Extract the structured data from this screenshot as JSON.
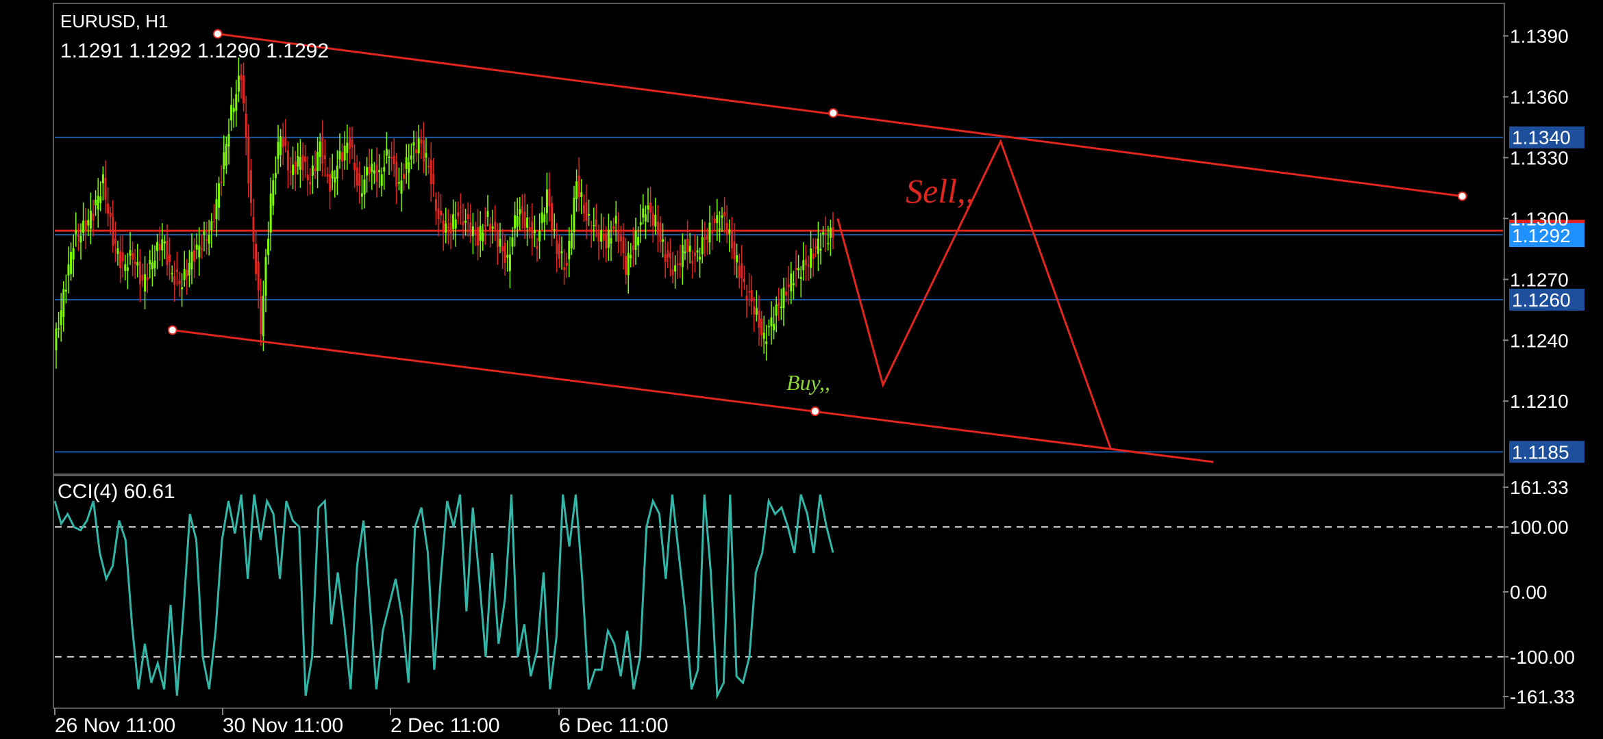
{
  "header": {
    "symbol": "EURUSD, H1",
    "ohlc": "1.1291 1.1292 1.1290 1.1292"
  },
  "indicator": {
    "label": "CCI(4) 60.61"
  },
  "annotations": {
    "sell": "Sell,,",
    "buy": "Buy,,"
  },
  "colors": {
    "background": "#000000",
    "bull": "#7cfc00",
    "bear": "#e0261f",
    "grid": "#1f3a7a",
    "level_line": "#1e5aa8",
    "trendline": "#e0261f",
    "cci": "#33b5a8",
    "sell_text": "#e0261f",
    "buy_text": "#8fd63a",
    "price_badge": "#1e90ff"
  },
  "chart_data": [
    {
      "type": "candlestick",
      "title": "EURUSD, H1",
      "ylim": [
        1.1175,
        1.1405
      ],
      "y_ticks": [
        "1.1390",
        "1.1360",
        "1.1330",
        "1.1300",
        "1.1270",
        "1.1240",
        "1.1210"
      ],
      "x_tick_labels": [
        "26 Nov 11:00",
        "30 Nov 11:00",
        "2 Dec 11:00",
        "6 Dec 11:00"
      ],
      "current_price": "1.1292",
      "horizontal_levels": [
        {
          "price": 1.134,
          "label": "1.1340"
        },
        {
          "price": 1.126,
          "label": "1.1260"
        },
        {
          "price": 1.1185,
          "label": "1.1185"
        },
        {
          "price": 1.1294,
          "label": ""
        }
      ],
      "close_path": [
        1.1235,
        1.1262,
        1.1289,
        1.1295,
        1.1303,
        1.1318,
        1.129,
        1.1276,
        1.1282,
        1.1268,
        1.1279,
        1.129,
        1.1272,
        1.1268,
        1.1281,
        1.1288,
        1.1295,
        1.1322,
        1.1352,
        1.1372,
        1.1304,
        1.1246,
        1.131,
        1.1342,
        1.1322,
        1.133,
        1.1318,
        1.1336,
        1.1316,
        1.133,
        1.1338,
        1.1312,
        1.1326,
        1.132,
        1.1334,
        1.1315,
        1.133,
        1.1338,
        1.1326,
        1.13,
        1.1294,
        1.1303,
        1.1297,
        1.129,
        1.13,
        1.129,
        1.1278,
        1.1305,
        1.1297,
        1.1288,
        1.1312,
        1.1284,
        1.1276,
        1.1318,
        1.13,
        1.1294,
        1.1288,
        1.1298,
        1.1276,
        1.129,
        1.1306,
        1.1298,
        1.1282,
        1.1274,
        1.1286,
        1.128,
        1.129,
        1.1298,
        1.13,
        1.1282,
        1.1266,
        1.1256,
        1.124,
        1.1252,
        1.1262,
        1.1272,
        1.1276,
        1.1283,
        1.1291,
        1.1292
      ],
      "trend_lines": [
        {
          "name": "channel-top",
          "start": [
            0.18,
            1.1391
          ],
          "end": [
            1.555,
            1.1311
          ],
          "anchors": [
            [
              0.18,
              1.1391
            ],
            [
              0.86,
              1.1352
            ],
            [
              1.555,
              1.1311
            ]
          ]
        },
        {
          "name": "channel-bottom",
          "start": [
            0.13,
            1.1245
          ],
          "end": [
            1.28,
            1.118
          ],
          "anchors": [
            [
              0.13,
              1.1245
            ],
            [
              0.84,
              1.1205
            ]
          ]
        },
        {
          "name": "projection-zigzag",
          "points": [
            [
              0.865,
              1.13
            ],
            [
              0.915,
              1.1218
            ],
            [
              1.045,
              1.1338
            ],
            [
              1.167,
              1.1186
            ]
          ]
        }
      ]
    },
    {
      "type": "line",
      "title": "CCI(4) 60.61",
      "ylim": [
        -161.33,
        161.33
      ],
      "y_ticks": [
        "161.33",
        "100.00",
        "0.00",
        "-100.00",
        "-161.33"
      ],
      "dashed_levels": [
        100,
        -100
      ],
      "series": [
        {
          "values": [
            140,
            105,
            120,
            100,
            95,
            110,
            140,
            60,
            20,
            40,
            110,
            80,
            -50,
            -150,
            -80,
            -140,
            -110,
            -150,
            -20,
            -160,
            -30,
            120,
            80,
            -100,
            -150,
            -60,
            80,
            140,
            90,
            150,
            20,
            150,
            80,
            140,
            120,
            20,
            140,
            110,
            100,
            -160,
            -100,
            130,
            140,
            -50,
            30,
            -50,
            -150,
            40,
            110,
            -20,
            -150,
            -60,
            -20,
            20,
            -40,
            -140,
            100,
            130,
            60,
            -120,
            20,
            140,
            100,
            150,
            -30,
            130,
            20,
            -100,
            60,
            -80,
            -10,
            150,
            -100,
            -50,
            -130,
            -90,
            30,
            -150,
            -70,
            150,
            70,
            150,
            20,
            -150,
            -120,
            -120,
            -60,
            -80,
            -130,
            -60,
            -150,
            -100,
            100,
            140,
            120,
            20,
            150,
            60,
            -30,
            -150,
            -120,
            150,
            30,
            -160,
            -140,
            150,
            -130,
            -140,
            -100,
            30,
            60,
            140,
            120,
            130,
            100,
            60,
            150,
            120,
            60,
            150,
            100,
            60.61
          ]
        }
      ]
    }
  ]
}
